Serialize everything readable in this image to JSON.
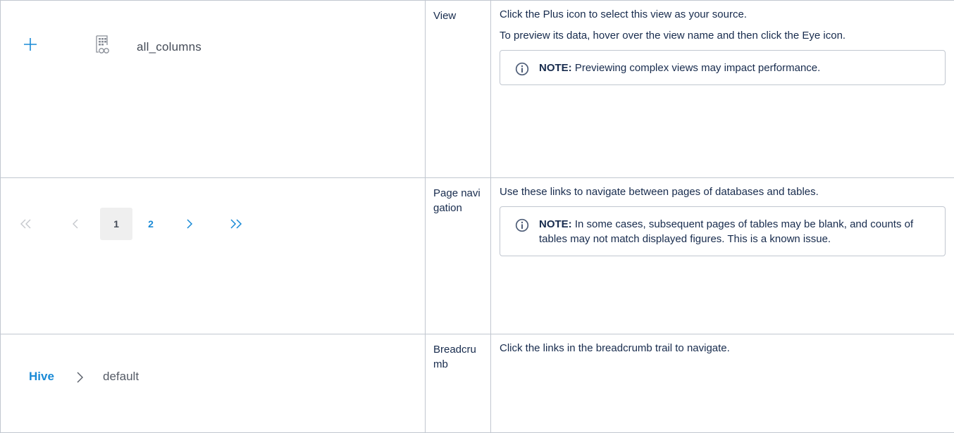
{
  "rows": [
    {
      "name": "View",
      "ui": {
        "icons": [
          "plus-icon",
          "view-icon"
        ],
        "view_name": "all_columns"
      },
      "paragraphs": [
        "Click the Plus icon to select this view as your source.",
        "To preview its data, hover over the view name and then click the Eye icon."
      ],
      "note": {
        "label": "NOTE:",
        "text": " Previewing complex views may impact performance."
      }
    },
    {
      "name": "Page navigation",
      "ui": {
        "icons": [
          "double-chevron-left-icon",
          "chevron-left-icon",
          "chevron-right-icon",
          "double-chevron-right-icon"
        ],
        "page_current": "1",
        "page_next": "2"
      },
      "paragraphs": [
        "Use these links to navigate between pages of databases and tables."
      ],
      "note": {
        "label": "NOTE:",
        "text": " In some cases, subsequent pages of tables may be blank, and counts of tables may not match displayed figures. This is a known issue."
      }
    },
    {
      "name": "Breadcrumb",
      "ui": {
        "crumb_root": "Hive",
        "crumb_current": "default",
        "icons": [
          "chevron-right-icon"
        ]
      },
      "paragraphs": [
        "Click the links in the breadcrumb trail to navigate."
      ]
    }
  ],
  "colors": {
    "link_blue": "#1a8ad6",
    "muted_gray": "#c4c7cc",
    "border": "#c1c7d0",
    "text": "#172b4d"
  }
}
